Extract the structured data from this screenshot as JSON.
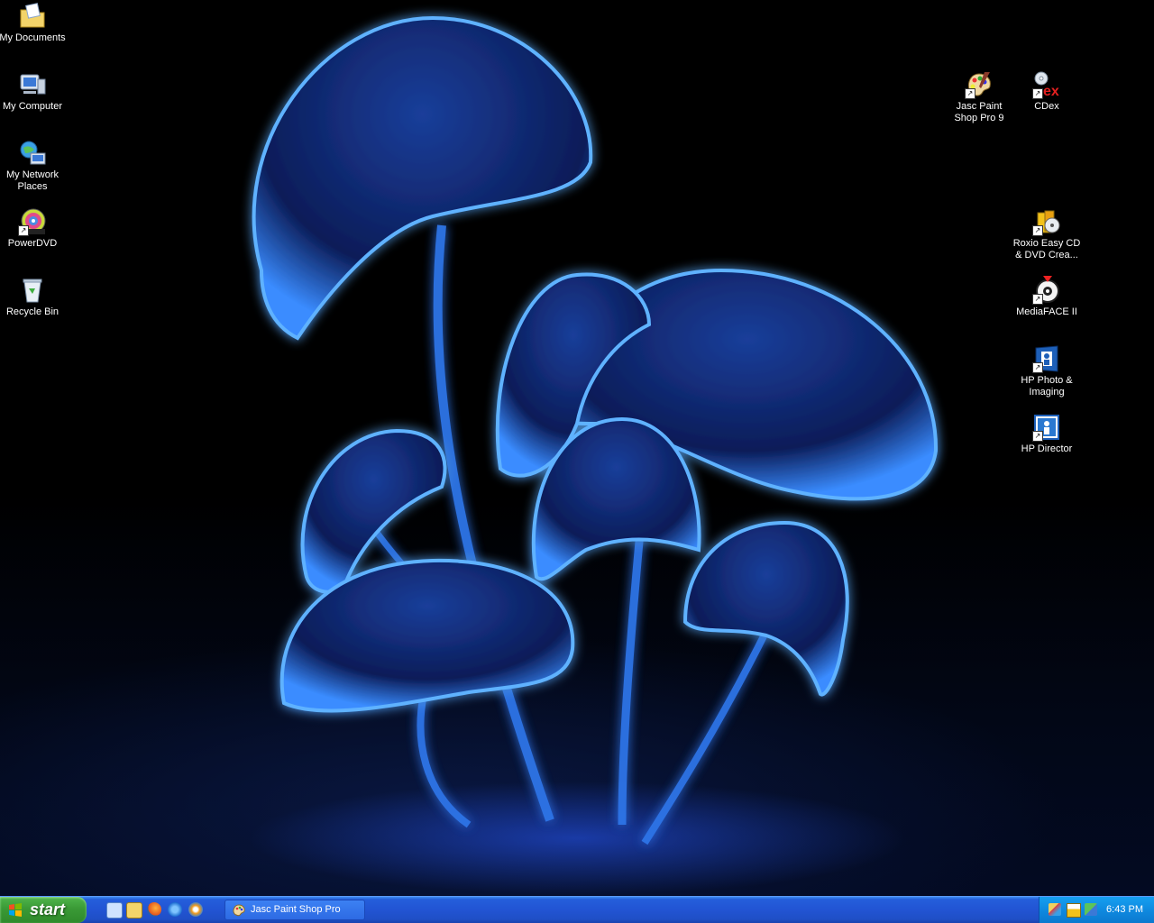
{
  "desktop": {
    "icons_left": [
      {
        "label": "My Documents",
        "icon": "documents-folder-icon"
      },
      {
        "label": "My Computer",
        "icon": "computer-icon"
      },
      {
        "label": "My Network Places",
        "icon": "network-icon"
      },
      {
        "label": "PowerDVD",
        "icon": "dvd-disc-icon"
      },
      {
        "label": "Recycle Bin",
        "icon": "recycle-bin-icon"
      }
    ],
    "icons_right": [
      {
        "label": "Jasc Paint Shop Pro 9",
        "icon": "paint-palette-icon"
      },
      {
        "label": "CDex",
        "icon": "cd-ex-icon"
      },
      {
        "label": "Roxio Easy CD & DVD Crea...",
        "icon": "roxio-icon"
      },
      {
        "label": "MediaFACE II",
        "icon": "mediaface-disc-icon"
      },
      {
        "label": "HP Photo & Imaging",
        "icon": "hp-photo-icon"
      },
      {
        "label": "HP Director",
        "icon": "hp-director-icon"
      }
    ],
    "wallpaper_accent": "#2a6cff"
  },
  "taskbar": {
    "start_label": "start",
    "quick_launch": [
      "show-desktop-icon",
      "explorer-folder-icon",
      "firefox-icon",
      "ie-icon",
      "media-player-icon"
    ],
    "tasks": [
      {
        "label": "Jasc Paint Shop Pro",
        "icon": "paint-palette-icon"
      }
    ],
    "tray_icons": [
      "network-tray-icon",
      "printer-tray-icon",
      "security-tray-icon"
    ],
    "clock": "6:43 PM"
  }
}
